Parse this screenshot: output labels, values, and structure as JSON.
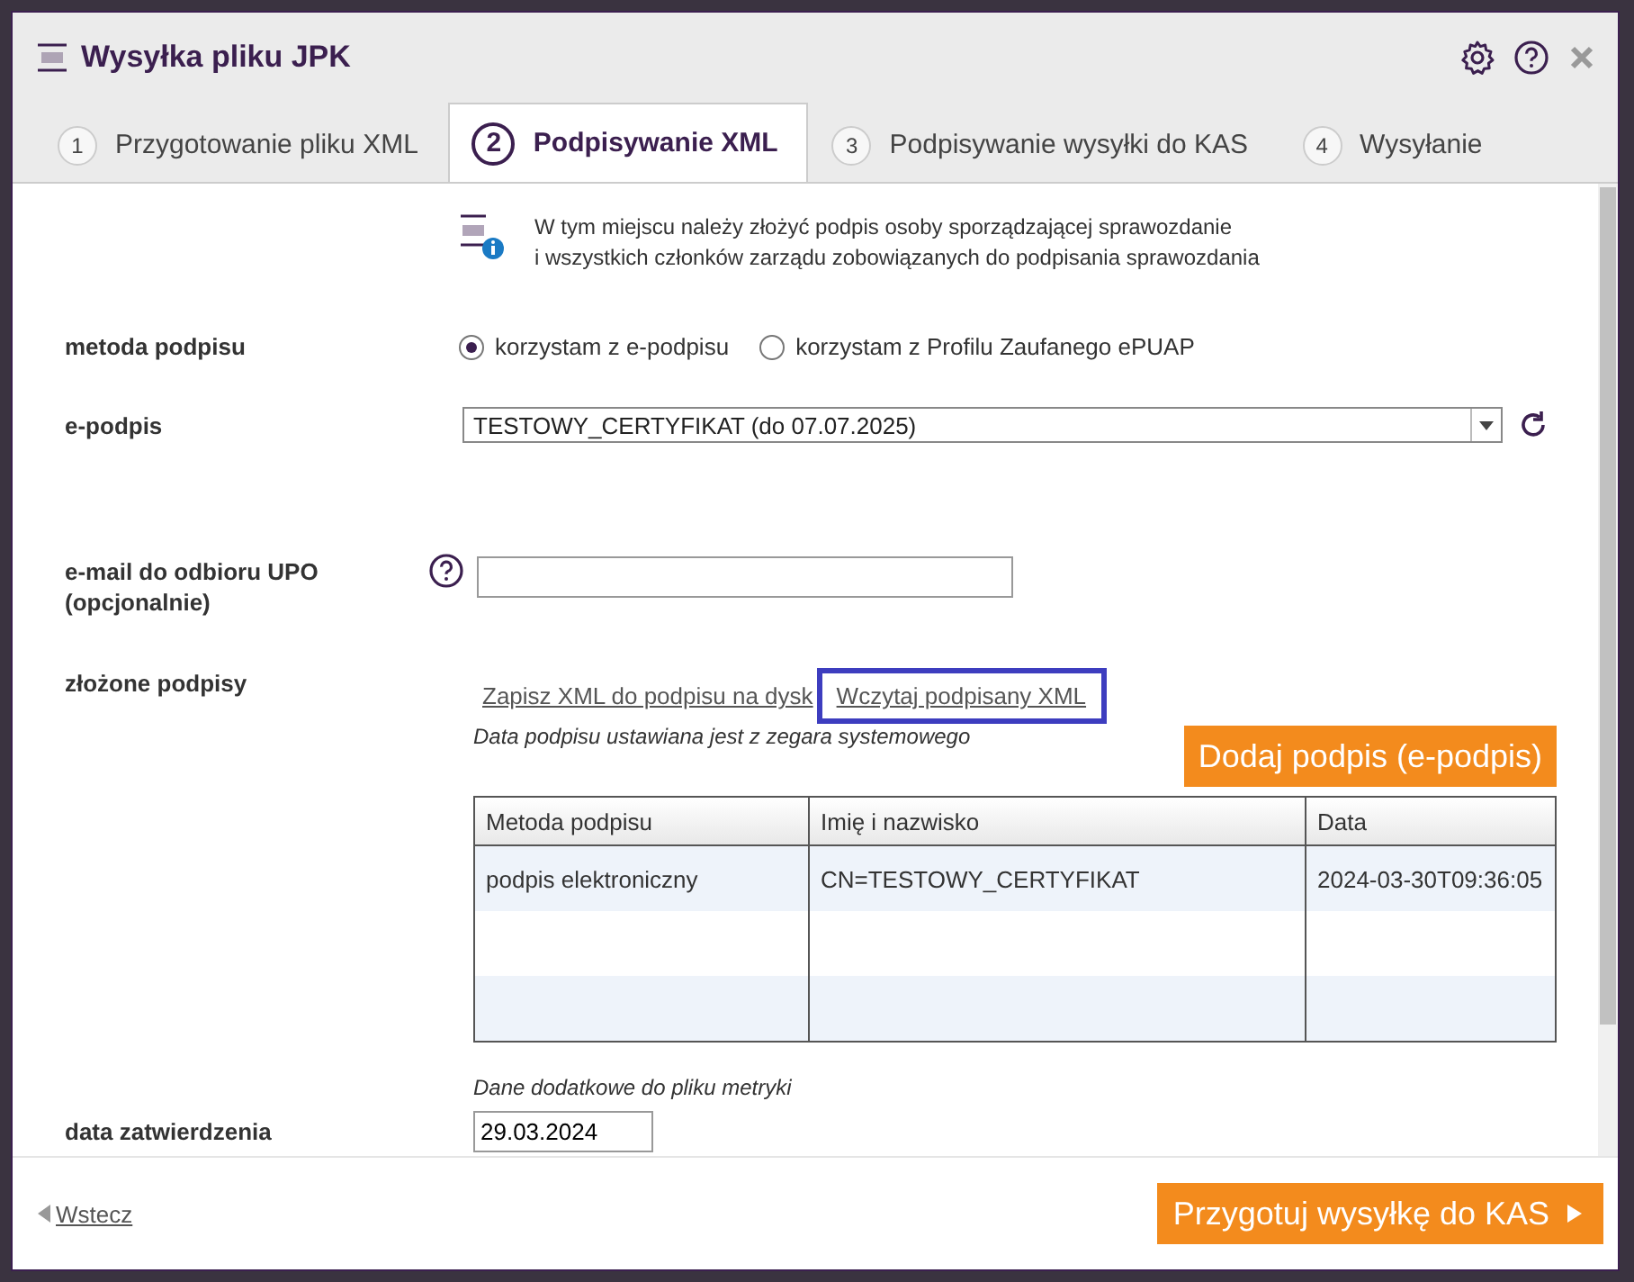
{
  "window": {
    "title": "Wysyłka pliku JPK"
  },
  "tabs": [
    {
      "number": "1",
      "label": "Przygotowanie pliku XML",
      "selected": false
    },
    {
      "number": "2",
      "label": "Podpisywanie XML",
      "selected": true
    },
    {
      "number": "3",
      "label": "Podpisywanie wysyłki do KAS",
      "selected": false
    },
    {
      "number": "4",
      "label": "Wysyłanie",
      "selected": false
    }
  ],
  "info": {
    "lines": [
      "W tym miejscu należy złożyć podpis osoby sporządzającej sprawozdanie",
      "i wszystkich członków zarządu zobowiązanych do podpisania sprawozdania"
    ]
  },
  "signature_method": {
    "label": "metoda podpisu",
    "options": [
      {
        "label": "korzystam z e-podpisu",
        "selected": true
      },
      {
        "label": "korzystam z Profilu Zaufanego ePUAP",
        "selected": false
      }
    ]
  },
  "e_signature": {
    "label": "e-podpis",
    "value": "TESTOWY_CERTYFIKAT (do 07.07.2025)"
  },
  "email": {
    "label": "e-mail do odbioru UPO (opcjonalnie)"
  },
  "signatures": {
    "label": "złożone podpisy",
    "links": [
      {
        "label": "Zapisz XML do podpisu na dysk",
        "highlighted": false
      },
      {
        "label": "Wczytaj podpisany XML",
        "highlighted": true
      }
    ],
    "note": "Data podpisu ustawiana jest z zegara systemowego",
    "add_button": "Dodaj podpis (e-podpis)",
    "table": {
      "columns": [
        "Metoda podpisu",
        "Imię i nazwisko",
        "Data"
      ],
      "rows": [
        [
          "podpis elektroniczny",
          "CN=TESTOWY_CERTYFIKAT",
          "2024-03-30T09:36:05"
        ]
      ]
    }
  },
  "metadata_note": "Dane dodatkowe do pliku metryki",
  "approval_date": {
    "label": "data zatwierdzenia",
    "value": "29.03.2024"
  },
  "footer": {
    "back": "Wstecz",
    "next": "Przygotuj wysyłkę do KAS"
  }
}
